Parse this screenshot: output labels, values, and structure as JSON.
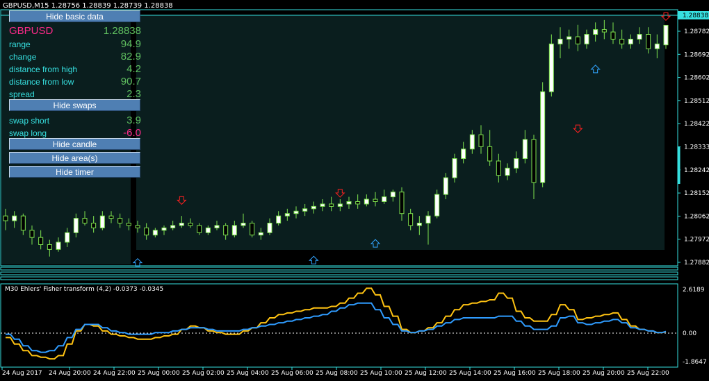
{
  "window": {
    "title": "GBPUSD,M15  1.28756 1.28839 1.28739 1.28838"
  },
  "panel": {
    "hide_basic_data": "Hide basic data",
    "symbol": "GBPUSD",
    "price": "1.28838",
    "rows": [
      {
        "label": "range",
        "value": "94.9"
      },
      {
        "label": "change",
        "value": "82.9"
      },
      {
        "label": "distance from high",
        "value": "4.2"
      },
      {
        "label": "distance from low",
        "value": "90.7"
      },
      {
        "label": "spread",
        "value": "2.3"
      }
    ],
    "hide_swaps": "Hide swaps",
    "swaps": [
      {
        "label": "swap short",
        "value": "3.9"
      },
      {
        "label": "swap long",
        "value": "-6.0"
      }
    ],
    "hide_candle": "Hide candle",
    "hide_areas": "Hide area(s)",
    "hide_timer": "Hide timer"
  },
  "colors": {
    "background": "#000000",
    "up_candle": "#ffffff",
    "down_candle": "#ffffff",
    "candle_outline": "#7fe34f",
    "price_line": "#36e0e0",
    "fisher_line": "#ffc312",
    "signal_line": "#2f9cff",
    "sell_arrow": "#ff2020",
    "buy_arrow": "#31a4ff"
  },
  "price_axis": {
    "labels": [
      "1.28838",
      "1.28782",
      "1.28692",
      "1.28602",
      "1.28512",
      "1.28422",
      "1.28333",
      "1.28242",
      "1.28152",
      "1.28062",
      "1.27972",
      "1.27882"
    ],
    "current": "1.28838"
  },
  "indicator": {
    "label": "M30 Ehlers' Fisher transform (4,2) -0.0373 -0.0345",
    "axis": [
      "2.6189",
      "0.00",
      "-1.8647"
    ]
  },
  "time_axis": [
    "24 Aug 2017",
    "24 Aug 20:00",
    "24 Aug 22:00",
    "25 Aug 00:00",
    "25 Aug 02:00",
    "25 Aug 04:00",
    "25 Aug 06:00",
    "25 Aug 08:00",
    "25 Aug 10:00",
    "25 Aug 12:00",
    "25 Aug 14:00",
    "25 Aug 16:00",
    "25 Aug 18:00",
    "25 Aug 20:00",
    "25 Aug 22:00"
  ],
  "chart_data": {
    "type": "candlestick",
    "symbol": "GBPUSD",
    "timeframe": "M15",
    "candles": [
      [
        1.2804,
        1.2807,
        1.2798,
        1.2802
      ],
      [
        1.2802,
        1.2806,
        1.2799,
        1.2804
      ],
      [
        1.2804,
        1.2805,
        1.2796,
        1.2798
      ],
      [
        1.2798,
        1.28,
        1.2792,
        1.2795
      ],
      [
        1.2795,
        1.2798,
        1.279,
        1.2792
      ],
      [
        1.2792,
        1.2794,
        1.2787,
        1.279
      ],
      [
        1.279,
        1.2795,
        1.2789,
        1.2793
      ],
      [
        1.2793,
        1.2799,
        1.2791,
        1.2797
      ],
      [
        1.2797,
        1.2805,
        1.2795,
        1.2803
      ],
      [
        1.2803,
        1.2806,
        1.28,
        1.2801
      ],
      [
        1.2801,
        1.2804,
        1.2797,
        1.2799
      ],
      [
        1.2799,
        1.2806,
        1.2798,
        1.2804
      ],
      [
        1.2804,
        1.2806,
        1.2801,
        1.2803
      ],
      [
        1.2803,
        1.2805,
        1.2799,
        1.2801
      ],
      [
        1.2801,
        1.2803,
        1.2798,
        1.28
      ],
      [
        1.28,
        1.2802,
        1.2797,
        1.2799
      ],
      [
        1.2799,
        1.2801,
        1.2794,
        1.2796
      ],
      [
        1.2796,
        1.2799,
        1.2795,
        1.2798
      ],
      [
        1.2798,
        1.28,
        1.2796,
        1.2799
      ],
      [
        1.2799,
        1.2802,
        1.2798,
        1.28
      ],
      [
        1.28,
        1.2804,
        1.2799,
        1.2801
      ],
      [
        1.2801,
        1.2803,
        1.2799,
        1.28
      ],
      [
        1.28,
        1.2801,
        1.2796,
        1.2797
      ],
      [
        1.2797,
        1.28,
        1.2796,
        1.2799
      ],
      [
        1.2799,
        1.2802,
        1.2798,
        1.28
      ],
      [
        1.28,
        1.2801,
        1.2794,
        1.2796
      ],
      [
        1.2796,
        1.2802,
        1.2795,
        1.28
      ],
      [
        1.28,
        1.2805,
        1.2799,
        1.2801
      ],
      [
        1.2801,
        1.2802,
        1.2795,
        1.2796
      ],
      [
        1.2796,
        1.2799,
        1.2794,
        1.2797
      ],
      [
        1.2797,
        1.2803,
        1.2796,
        1.2801
      ],
      [
        1.2801,
        1.2806,
        1.28,
        1.2804
      ],
      [
        1.2804,
        1.2807,
        1.2802,
        1.2805
      ],
      [
        1.2805,
        1.2808,
        1.2803,
        1.2806
      ],
      [
        1.2806,
        1.2809,
        1.2804,
        1.2807
      ],
      [
        1.2807,
        1.281,
        1.2805,
        1.2808
      ],
      [
        1.2808,
        1.2811,
        1.2806,
        1.2809
      ],
      [
        1.2809,
        1.2812,
        1.2806,
        1.2808
      ],
      [
        1.2808,
        1.2811,
        1.2806,
        1.2809
      ],
      [
        1.2809,
        1.2812,
        1.2807,
        1.281
      ],
      [
        1.281,
        1.2813,
        1.2807,
        1.2809
      ],
      [
        1.2809,
        1.2813,
        1.2808,
        1.2811
      ],
      [
        1.2811,
        1.2814,
        1.2808,
        1.281
      ],
      [
        1.281,
        1.2815,
        1.2809,
        1.2812
      ],
      [
        1.2812,
        1.2815,
        1.281,
        1.2814
      ],
      [
        1.2814,
        1.2816,
        1.2802,
        1.2805
      ],
      [
        1.2805,
        1.2807,
        1.2798,
        1.28
      ],
      [
        1.28,
        1.2804,
        1.2796,
        1.2801
      ],
      [
        1.2801,
        1.2806,
        1.2792,
        1.2804
      ],
      [
        1.2804,
        1.2815,
        1.2803,
        1.2813
      ],
      [
        1.2813,
        1.2822,
        1.2811,
        1.282
      ],
      [
        1.282,
        1.283,
        1.2818,
        1.2828
      ],
      [
        1.2828,
        1.2835,
        1.2826,
        1.2832
      ],
      [
        1.2832,
        1.284,
        1.283,
        1.2838
      ],
      [
        1.2838,
        1.2842,
        1.283,
        1.2833
      ],
      [
        1.2833,
        1.284,
        1.2825,
        1.2827
      ],
      [
        1.2827,
        1.283,
        1.2818,
        1.2821
      ],
      [
        1.2821,
        1.2826,
        1.2819,
        1.2824
      ],
      [
        1.2824,
        1.2831,
        1.2822,
        1.2828
      ],
      [
        1.2828,
        1.284,
        1.2826,
        1.2836
      ],
      [
        1.2836,
        1.2838,
        1.2811,
        1.2818
      ],
      [
        1.2818,
        1.286,
        1.2816,
        1.2856
      ],
      [
        1.2856,
        1.288,
        1.2854,
        1.2876
      ],
      [
        1.2876,
        1.2883,
        1.287,
        1.2878
      ],
      [
        1.2878,
        1.2882,
        1.2874,
        1.2879
      ],
      [
        1.2879,
        1.2884,
        1.2873,
        1.2876
      ],
      [
        1.2876,
        1.2882,
        1.2874,
        1.288
      ],
      [
        1.288,
        1.2885,
        1.2877,
        1.2882
      ],
      [
        1.2882,
        1.2886,
        1.2878,
        1.2881
      ],
      [
        1.2881,
        1.2885,
        1.2876,
        1.2878
      ],
      [
        1.2878,
        1.2882,
        1.2874,
        1.2876
      ],
      [
        1.2876,
        1.288,
        1.2874,
        1.2878
      ],
      [
        1.2878,
        1.2883,
        1.2876,
        1.288
      ],
      [
        1.288,
        1.2883,
        1.2872,
        1.2874
      ],
      [
        1.2874,
        1.288,
        1.287,
        1.2876
      ],
      [
        1.28756,
        1.28839,
        1.28739,
        1.28838
      ]
    ],
    "sell_arrows": [
      1.2808,
      1.2811,
      1.2838,
      1.2885
    ],
    "buy_arrows": [
      1.2787,
      1.2788,
      1.2795,
      1.2868
    ],
    "fisher": [
      -0.4,
      -0.8,
      -1.2,
      -1.5,
      -1.6,
      -1.7,
      -1.5,
      -0.8,
      0.0,
      0.4,
      0.3,
      0.0,
      -0.2,
      -0.3,
      -0.4,
      -0.5,
      -0.5,
      -0.4,
      -0.3,
      -0.2,
      0.1,
      0.3,
      0.2,
      0.0,
      -0.1,
      -0.2,
      -0.2,
      0.0,
      0.2,
      0.5,
      0.8,
      1.0,
      1.1,
      1.2,
      1.3,
      1.4,
      1.4,
      1.5,
      1.7,
      2.0,
      2.3,
      2.6,
      2.2,
      1.5,
      0.9,
      0.1,
      -0.1,
      0.0,
      0.2,
      0.5,
      0.9,
      1.3,
      1.6,
      1.7,
      1.8,
      1.9,
      2.3,
      2.0,
      1.2,
      0.8,
      0.6,
      0.6,
      1.0,
      1.6,
      1.3,
      0.7,
      0.8,
      0.9,
      1.0,
      1.1,
      0.7,
      0.3,
      0.1,
      0.0,
      -0.1,
      -0.04
    ],
    "signal": [
      -0.2,
      -0.5,
      -0.9,
      -1.2,
      -1.3,
      -1.2,
      -0.9,
      -0.4,
      0.1,
      0.4,
      0.4,
      0.2,
      0.0,
      -0.1,
      -0.2,
      -0.2,
      -0.2,
      -0.1,
      -0.1,
      0.0,
      0.1,
      0.2,
      0.2,
      0.1,
      0.0,
      0.0,
      0.0,
      0.1,
      0.2,
      0.3,
      0.4,
      0.5,
      0.6,
      0.7,
      0.8,
      0.9,
      1.0,
      1.2,
      1.4,
      1.6,
      1.7,
      1.7,
      1.3,
      0.8,
      0.4,
      0.0,
      -0.1,
      0.0,
      0.1,
      0.3,
      0.5,
      0.7,
      0.8,
      0.8,
      0.8,
      0.8,
      0.9,
      0.9,
      0.6,
      0.3,
      0.1,
      0.1,
      0.3,
      0.8,
      0.9,
      0.5,
      0.4,
      0.5,
      0.6,
      0.7,
      0.5,
      0.2,
      0.1,
      0.0,
      -0.1,
      -0.03
    ],
    "ylim_price": [
      1.2784,
      1.2888
    ],
    "ylim_indicator": [
      -1.8647,
      2.6189
    ]
  }
}
